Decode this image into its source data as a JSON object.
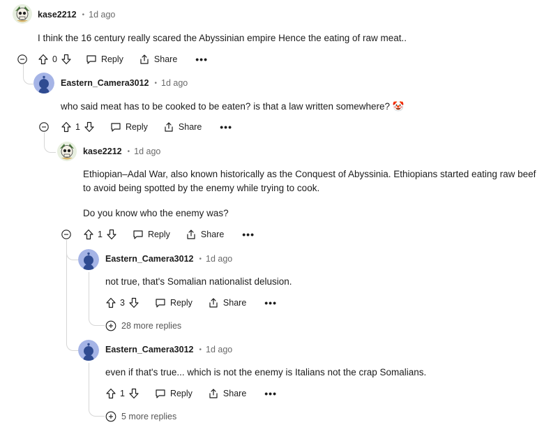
{
  "comments": [
    {
      "user": "kase2212",
      "time": "1d ago",
      "text": "I think the 16 century really scared the Abyssinian empire Hence the eating of raw meat..",
      "votes": "0"
    },
    {
      "user": "Eastern_Camera3012",
      "time": "1d ago",
      "text": "who said meat has to be cooked to be eaten? is that a law written somewhere?",
      "votes": "1",
      "emoji": "🤡"
    },
    {
      "user": "kase2212",
      "time": "1d ago",
      "text": "Ethiopian–Adal War, also known historically as the Conquest of Abyssinia. Ethiopians started eating raw beef to avoid being spotted by the enemy while trying to cook.",
      "text2": "Do you know who the enemy was?",
      "votes": "1"
    },
    {
      "user": "Eastern_Camera3012",
      "time": "1d ago",
      "text": "not true, that's Somalian nationalist delusion.",
      "votes": "3",
      "more_replies": "28 more replies"
    },
    {
      "user": "Eastern_Camera3012",
      "time": "1d ago",
      "text": "even if that's true... which is not the enemy is Italians not the crap Somalians.",
      "votes": "1",
      "more_replies": "5 more replies"
    }
  ],
  "labels": {
    "reply": "Reply",
    "share": "Share",
    "more": "•••",
    "dot": "•"
  },
  "colors": {
    "line": "#d6d6d6",
    "snoo_bg": "#a5b4e6",
    "snoo_body": "#2f4b91"
  }
}
